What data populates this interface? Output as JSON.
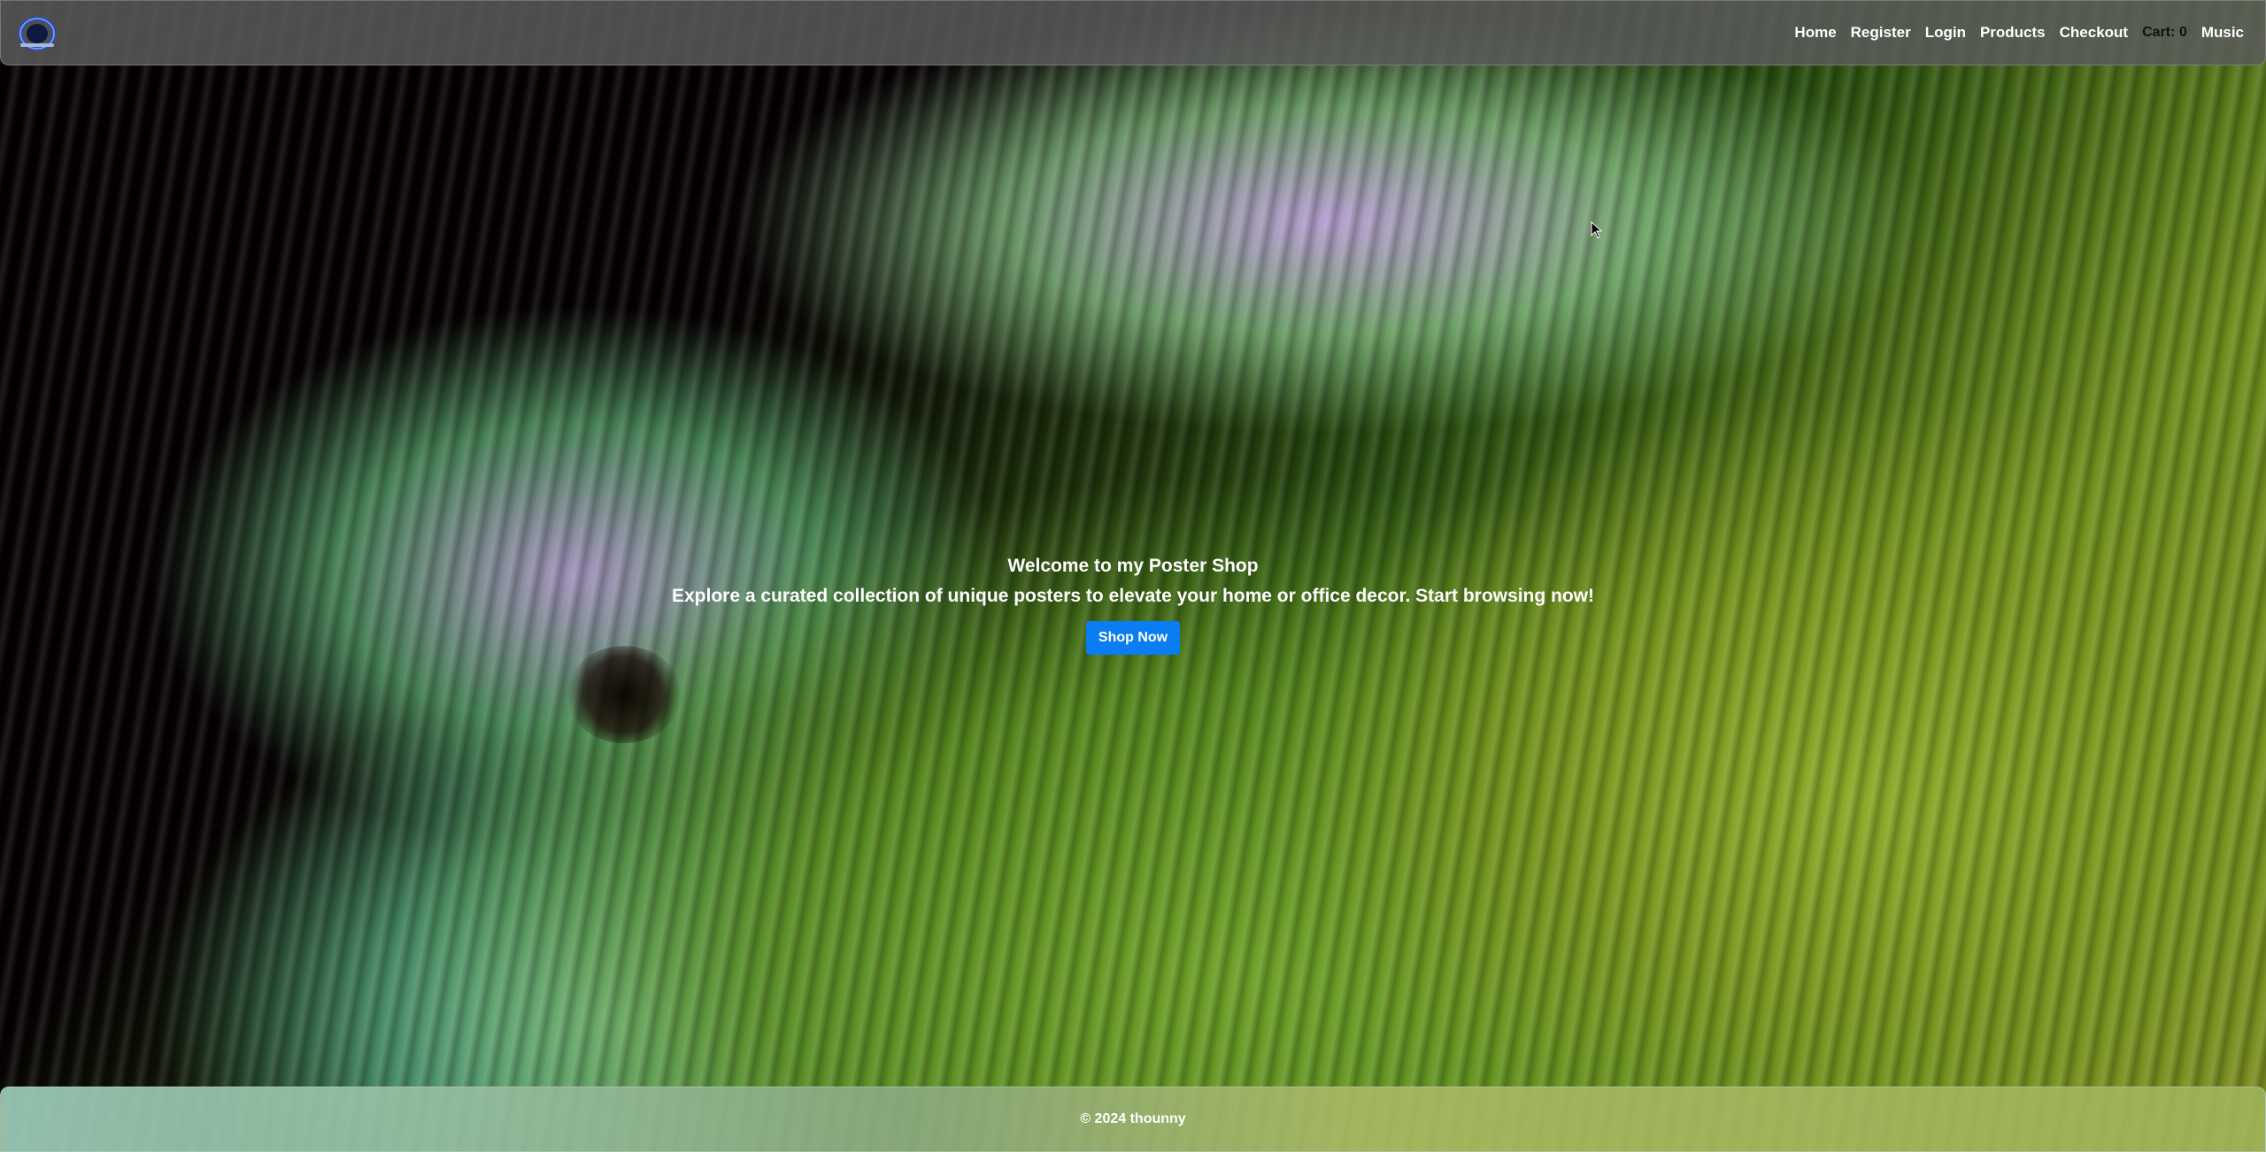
{
  "header": {
    "logo_icon": "ring-logo-icon",
    "nav": [
      {
        "label": "Home"
      },
      {
        "label": "Register"
      },
      {
        "label": "Login"
      },
      {
        "label": "Products"
      },
      {
        "label": "Checkout"
      }
    ],
    "cart_label": "Cart:",
    "cart_count": "0",
    "music_label": "Music"
  },
  "hero": {
    "title": "Welcome to my Poster Shop",
    "subtitle": "Explore a curated collection of unique posters to elevate your home or office decor. Start browsing now!",
    "cta_label": "Shop Now"
  },
  "footer": {
    "text": "© 2024 thounny"
  },
  "colors": {
    "cta": "#0a7df2",
    "navbar": "#5a5a5a",
    "text": "#ffffff"
  }
}
